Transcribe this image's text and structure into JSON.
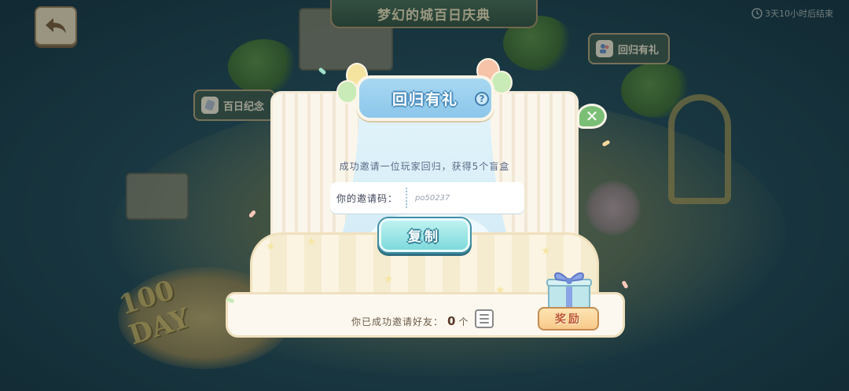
{
  "hud": {
    "event_title": "梦幻的城百日庆典",
    "timer_text": "3天10小时后结束",
    "side_buttons": {
      "return_gift": "回归有礼",
      "anniversary": "百日纪念"
    }
  },
  "modal": {
    "title": "回归有礼",
    "description": "成功邀请一位玩家回归，获得5个盲盒",
    "code_label": "你的邀请码：",
    "code_value": "po50237",
    "copy_label": "复制",
    "invited_prefix": "你已成功邀请好友：",
    "invited_count": "0",
    "invited_suffix": "个",
    "reward_label": "奖励"
  },
  "decor": {
    "bg_badge": "100 DAY"
  },
  "colors": {
    "accent_blue": "#8cc6ea",
    "copy_button": "#7dd9dc",
    "reward_button": "#f7c98a",
    "close_button": "#7bbf76"
  },
  "icons": {
    "back": "back-arrow-icon",
    "timer": "clock-icon",
    "help": "question-icon",
    "close": "close-icon",
    "gift": "gift-box-icon",
    "list": "list-icon"
  }
}
